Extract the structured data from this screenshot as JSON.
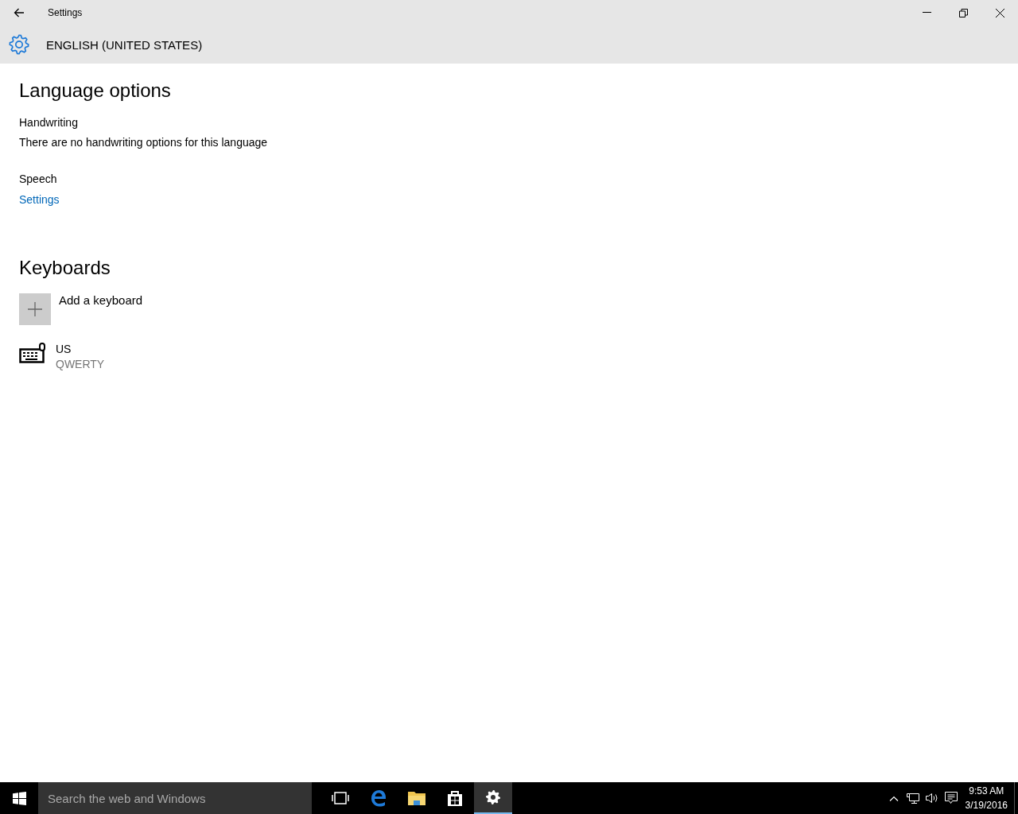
{
  "window": {
    "title": "Settings"
  },
  "header": {
    "title": "ENGLISH (UNITED STATES)"
  },
  "sections": [
    {
      "heading": "Language options",
      "groups": [
        {
          "label": "Handwriting",
          "text": "There are no handwriting options for this language"
        },
        {
          "label": "Speech",
          "link": "Settings"
        }
      ]
    },
    {
      "heading": "Keyboards",
      "add_button": "Add a keyboard",
      "keyboards": [
        {
          "name": "US",
          "layout": "QWERTY"
        }
      ]
    }
  ],
  "taskbar": {
    "search": {
      "placeholder": "Search the web and Windows"
    },
    "apps": [
      {
        "kind": "taskview",
        "selected": false
      },
      {
        "kind": "edge",
        "selected": false
      },
      {
        "kind": "explorer",
        "selected": false
      },
      {
        "kind": "store",
        "selected": false
      },
      {
        "kind": "settings",
        "selected": true
      }
    ],
    "time": "9:53 AM",
    "date": "3/19/2016"
  }
}
